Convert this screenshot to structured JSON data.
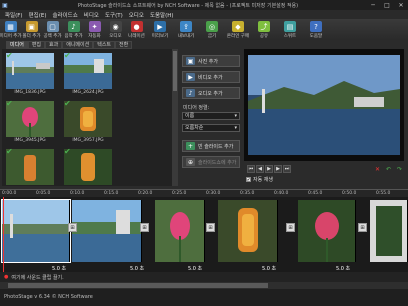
{
  "window": {
    "title": "PhotoStage 슬라이드쇼 소프트웨어 by NCH Software - 제목 없음 - (프로젝트 미저장 기본설정 적용)",
    "minimize": "─",
    "maximize": "□",
    "close": "✕"
  },
  "menu": [
    "파일(F)",
    "편집(E)",
    "슬라이드쇼",
    "비디오",
    "도구(T)",
    "오디오",
    "도움말(H)"
  ],
  "toolbar": [
    {
      "label": "미디어 추가",
      "icon": "▦",
      "color": "#3f7fbf"
    },
    {
      "label": "폴더 추가",
      "icon": "▣",
      "color": "#c79a2f"
    },
    {
      "label": "공백 추가",
      "icon": "▢",
      "color": "#6b8fb0"
    },
    {
      "label": "음악 추가",
      "icon": "♪",
      "color": "#3c8f5c"
    },
    {
      "label": "자동화",
      "icon": "✦",
      "color": "#8a5ab0"
    },
    {
      "label": "오디오",
      "icon": "◉",
      "color": "#444444"
    },
    {
      "label": "나레이션",
      "icon": "●",
      "color": "#c23030"
    },
    {
      "label": "미리보기",
      "icon": "▶",
      "color": "#2d6fa8"
    },
    {
      "label": "내보내기",
      "icon": "⇪",
      "color": "#3d86c6"
    },
    {
      "label": "굽기",
      "icon": "◎",
      "color": "#4aa04a"
    },
    {
      "label": "온라인 구매",
      "icon": "◆",
      "color": "#c7b02f"
    },
    {
      "label": "공유",
      "icon": "⤴",
      "color": "#7fbf3f"
    },
    {
      "label": "스위트",
      "icon": "▤",
      "color": "#3f9f9f"
    },
    {
      "label": "도움말",
      "icon": "?",
      "color": "#3f6fbf"
    }
  ],
  "tabs": [
    "미디어",
    "편집",
    "효과",
    "애니메이션",
    "텍스트",
    "전환"
  ],
  "media_items": [
    {
      "name": "IMG_1836.JPG",
      "checked": true
    },
    {
      "name": "IMG_2624.JPG",
      "checked": true
    },
    {
      "name": "IMG_3945.JPG",
      "checked": true
    },
    {
      "name": "IMG_3957.JPG",
      "checked": true
    },
    {
      "name": "",
      "checked": true
    },
    {
      "name": "",
      "checked": true
    }
  ],
  "side_panel": {
    "add_photo": "사진 추가",
    "add_video": "비디오 추가",
    "add_audio": "오디오 추가",
    "media_sort_label": "미디어 정렬:",
    "sort_by": "이름",
    "sort_order": "오름차순",
    "new_slide": "빈 슬라이드 추가",
    "add_to_slideshow": "슬라이드쇼에 추가"
  },
  "preview": {
    "auto_play_label": "자동 재생",
    "auto_play_checked": true
  },
  "ruler_ticks": [
    "0:00.0",
    "0:05.0",
    "0:10.0",
    "0:15.0",
    "0:20.0",
    "0:25.0",
    "0:30.0",
    "0:35.0",
    "0:40.0",
    "0:45.0",
    "0:50.0",
    "0:55.0",
    "1:00.0"
  ],
  "clips": [
    {
      "duration": "5.0 초"
    },
    {
      "duration": "5.0 초"
    },
    {
      "duration": "5.0 초"
    },
    {
      "duration": "5.0 초"
    },
    {
      "duration": "5.0 초"
    },
    {
      "duration": ""
    }
  ],
  "audio_track": {
    "hint": "여기에 사운드 클립 끌기."
  },
  "status": {
    "text": "PhotoStage v 6.34 © NCH Software"
  }
}
